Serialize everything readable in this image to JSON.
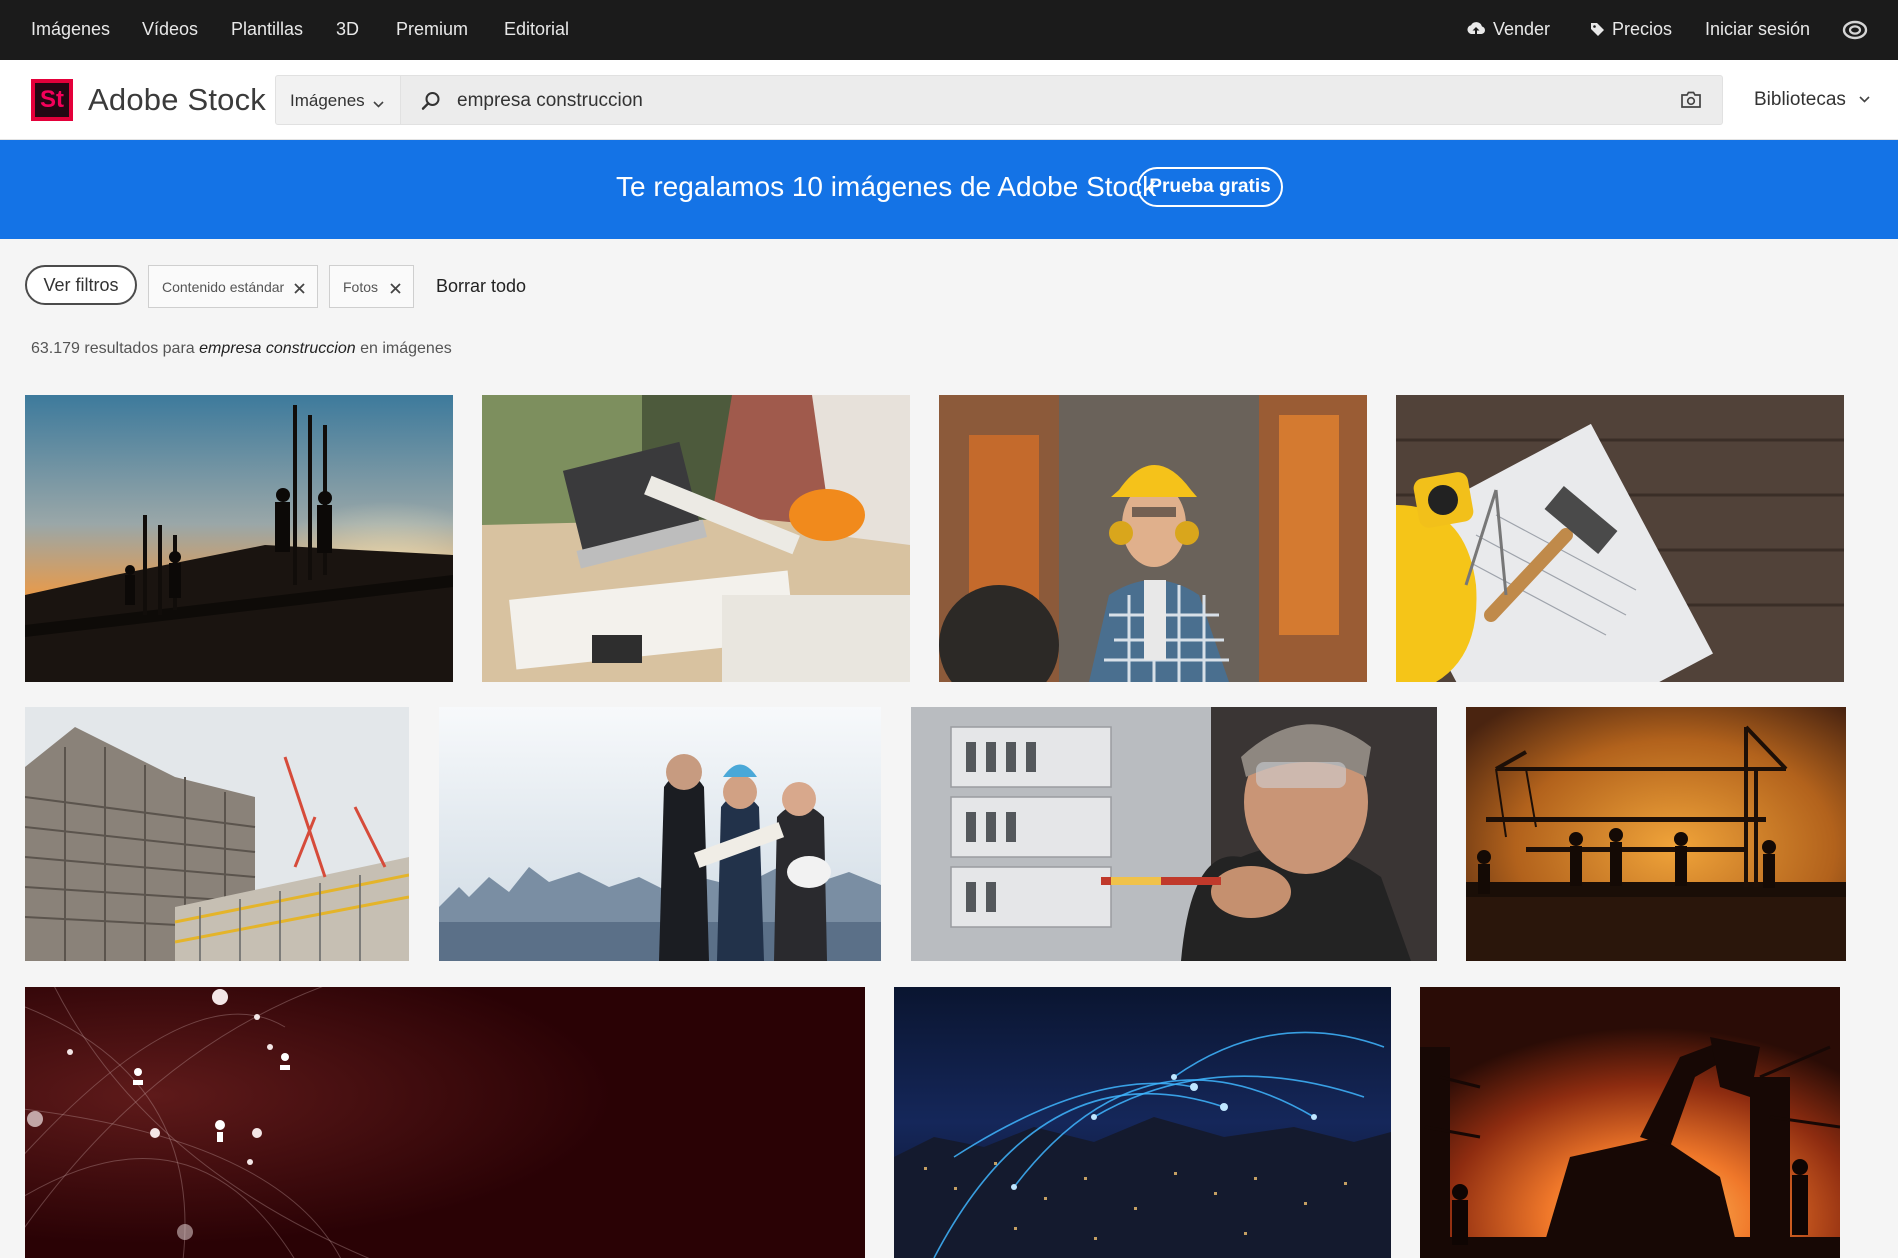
{
  "topnav": {
    "items": [
      "Imágenes",
      "Vídeos",
      "Plantillas",
      "3D",
      "Premium",
      "Editorial"
    ],
    "sell": "Vender",
    "pricing": "Precios",
    "signin": "Iniciar sesión"
  },
  "header": {
    "logo_mark": "St",
    "brand": "Adobe Stock",
    "search_type": "Imágenes",
    "search_value": "empresa construccion",
    "libraries": "Bibliotecas"
  },
  "promo": {
    "message": "Te regalamos 10 imágenes de Adobe Stock",
    "button": "Prueba gratis"
  },
  "filters": {
    "toggle": "Ver filtros",
    "chips": [
      "Contenido estándar",
      "Fotos"
    ],
    "clear": "Borrar todo"
  },
  "results": {
    "count": "63.179",
    "label": "resultados para",
    "query": "empresa construccion",
    "suffix": "en imágenes"
  },
  "images": [
    {
      "subject": "workers silhouette on scaffolding at sunset"
    },
    {
      "subject": "architects reviewing blueprints with laptop and hard hat"
    },
    {
      "subject": "smiling construction worker with yellow helmet"
    },
    {
      "subject": "yellow helmet, tape measure, hammer on plans"
    },
    {
      "subject": "high-rise building under construction with cranes"
    },
    {
      "subject": "business team with helmet and blueprints over city"
    },
    {
      "subject": "electrician working on fuse panel"
    },
    {
      "subject": "crane and workers silhouette at sunset"
    },
    {
      "subject": "dark red network people connections"
    },
    {
      "subject": "night city with blue network connections"
    },
    {
      "subject": "excavator and workers at orange sunset"
    }
  ],
  "colors": {
    "topnav_bg": "#1b1b1b",
    "promo_bg": "#1473e6",
    "logo_accent": "#e4003a"
  }
}
